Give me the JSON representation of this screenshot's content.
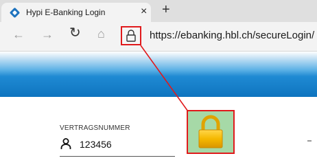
{
  "browser": {
    "tab": {
      "title": "Hypi E-Banking Login",
      "close_glyph": "×",
      "favicon": "hbl-diamond-icon"
    },
    "new_tab_glyph": "+",
    "nav": {
      "back_glyph": "←",
      "forward_glyph": "→",
      "reload_glyph": "↻",
      "home_glyph": "⌂"
    },
    "address": {
      "url": "https://ebanking.hbl.ch/secureLogin/",
      "security_icon": "lock-icon"
    }
  },
  "colors": {
    "highlight": "#e0191b",
    "banner_blue": "#0e74bf",
    "zoom_background": "#a6d9a7",
    "lock_gold": "#f2b800"
  },
  "login_form": {
    "contract_label": "VERTRAGSNUMMER",
    "contract_value": "123456",
    "field_icon": "user-icon"
  },
  "annotation": {
    "zoomed_icon": "lock-icon"
  }
}
